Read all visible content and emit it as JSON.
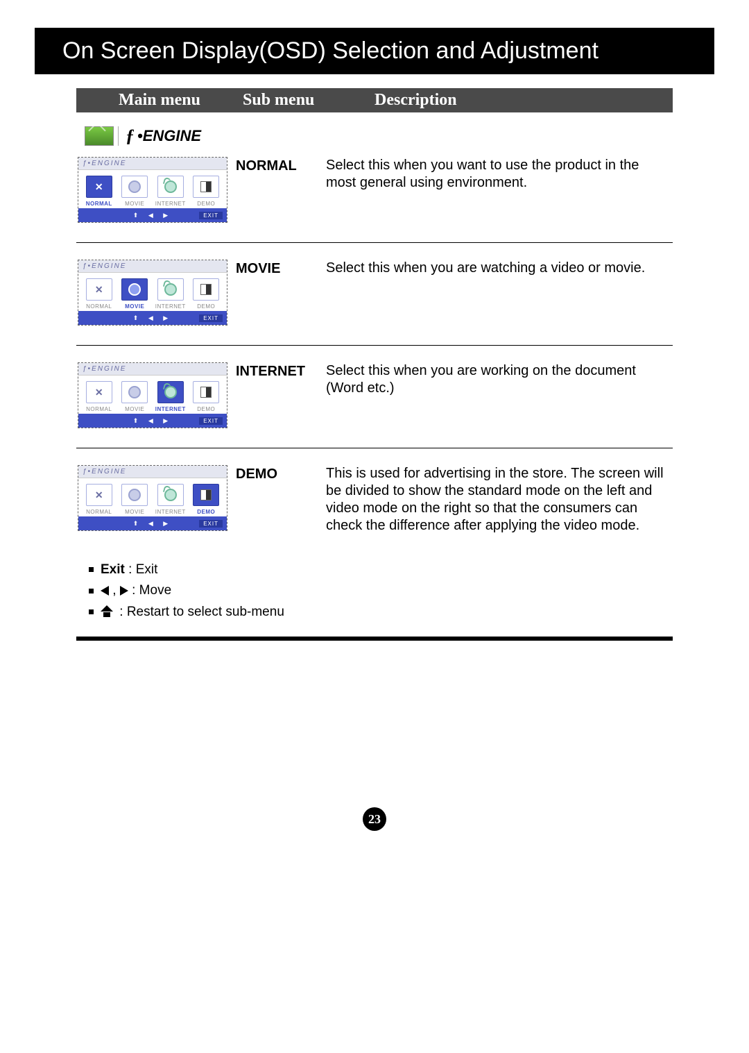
{
  "page_title": "On Screen Display(OSD) Selection and Adjustment",
  "headers": {
    "main": "Main menu",
    "sub": "Sub menu",
    "desc": "Description"
  },
  "engine_label": "ENGINE",
  "osd_header": "ƒ•ENGINE",
  "osd_options": {
    "normal": "NORMAL",
    "movie": "MOVIE",
    "internet": "INTERNET",
    "demo": "DEMO"
  },
  "osd_exit": "EXIT",
  "rows": [
    {
      "sub": "NORMAL",
      "desc": "Select this when you want to use the product in the most general using environment."
    },
    {
      "sub": "MOVIE",
      "desc": "Select this when you are watching a video or movie."
    },
    {
      "sub": "INTERNET",
      "desc": "Select this when you are working on the document (Word etc.)"
    },
    {
      "sub": "DEMO",
      "desc": "This is used for advertising in the store. The screen will be divided to show the standard mode on the left and video mode on the right so that the consumers can check the difference after applying the video mode."
    }
  ],
  "legend": {
    "exit_label": "Exit",
    "exit_desc": ": Exit",
    "move_desc": ": Move",
    "restart_desc": ": Restart to select sub-menu"
  },
  "page_number": "23"
}
